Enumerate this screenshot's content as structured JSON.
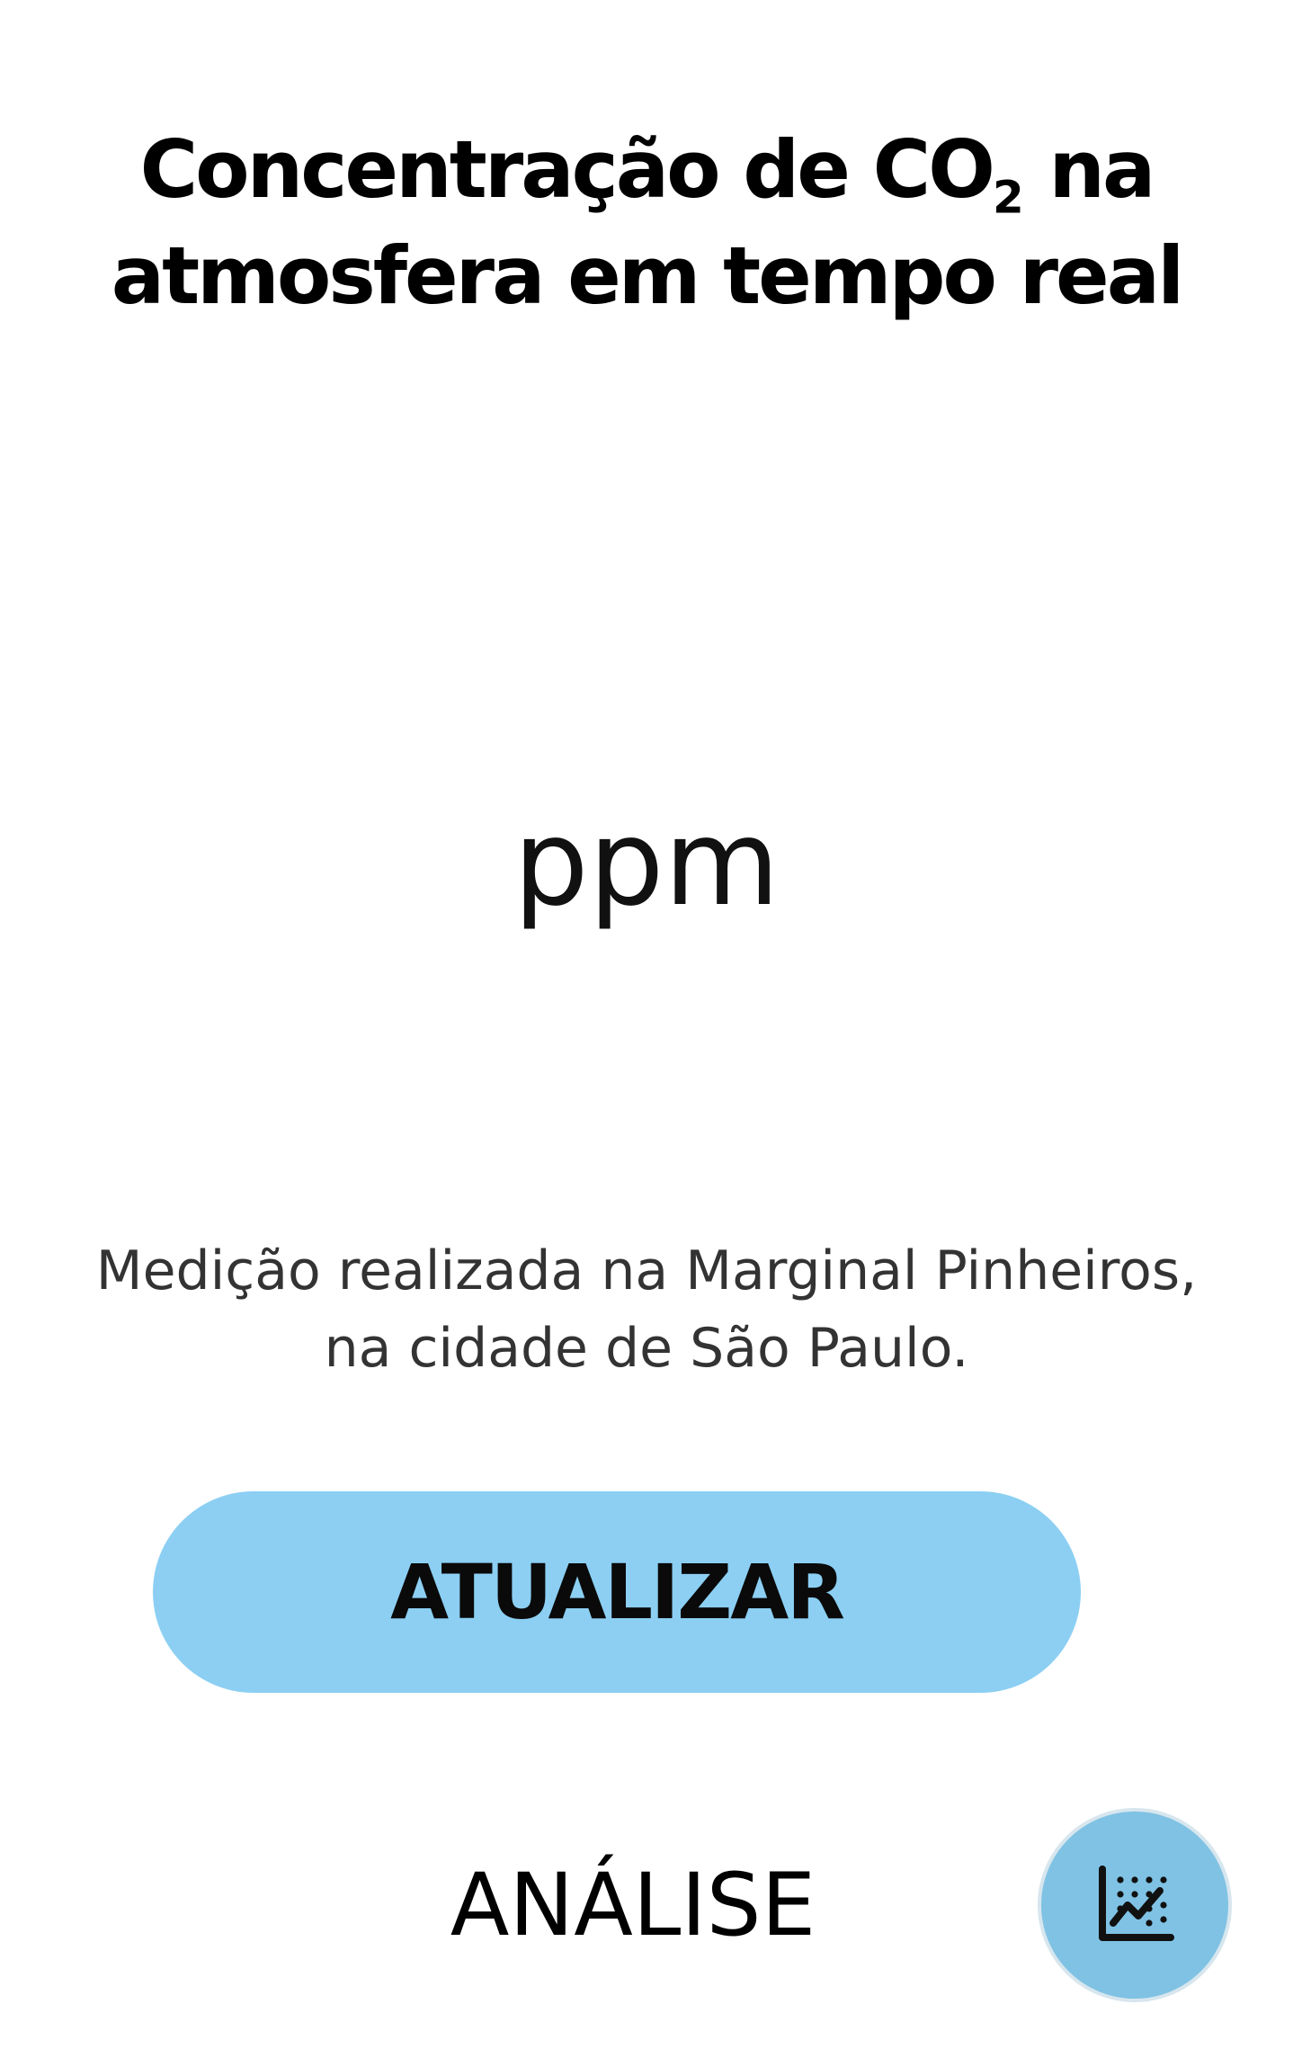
{
  "header": {
    "title_part1": "Concentração de CO",
    "title_subscript": "2",
    "title_part2": " na atmosfera em tempo real"
  },
  "reading": {
    "unit": "ppm"
  },
  "location": {
    "text": "Medição realizada na Marginal Pinheiros, na cidade de São Paulo."
  },
  "actions": {
    "update_label": "ATUALIZAR",
    "analysis_label": "ANÁLISE",
    "analysis_icon": "chart-analytics-icon"
  },
  "colors": {
    "button": "#8ccff3",
    "fab": "#7fc2e4"
  }
}
